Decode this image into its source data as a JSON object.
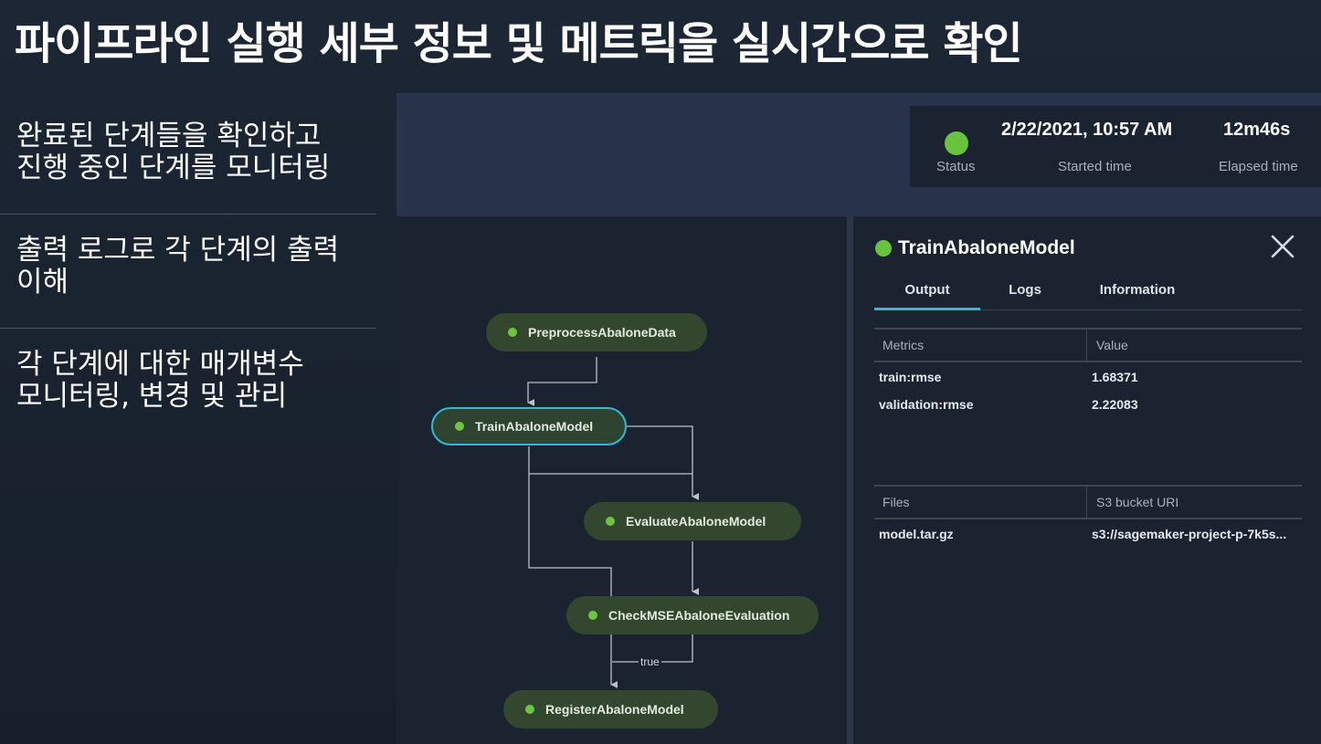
{
  "slide": {
    "title": "파이프라인 실행 세부 정보 및 메트릭을 실시간으로 확인",
    "bullets": [
      {
        "lines": [
          "완료된 단계들을 확인하고",
          "진행 중인 단계를 모니터링"
        ]
      },
      {
        "lines": [
          "출력 로그로 각 단계의 출력",
          "이해"
        ]
      },
      {
        "lines": [
          "각 단계에 대한 매개변수",
          "모니터링, 변경 및 관리"
        ]
      }
    ]
  },
  "header": {
    "status_label": "Status",
    "status_color": "#69c33f",
    "started_time": "2/22/2021, 10:57 AM",
    "started_label": "Started time",
    "elapsed_time": "12m46s",
    "elapsed_label": "Elapsed time"
  },
  "graph": {
    "nodes": [
      {
        "label": "PreprocessAbaloneData"
      },
      {
        "label": "TrainAbaloneModel"
      },
      {
        "label": "EvaluateAbaloneModel"
      },
      {
        "label": "CheckMSEAbaloneEvaluation"
      },
      {
        "label": "RegisterAbaloneModel"
      }
    ],
    "edge_label": "true",
    "selected_color": "#37b6d6",
    "success_color": "#6dc542"
  },
  "detail": {
    "title": "TrainAbaloneModel",
    "tabs": [
      "Output",
      "Logs",
      "Information"
    ],
    "active_tab": "Output",
    "metrics_header": [
      "Metrics",
      "Value"
    ],
    "metrics": [
      {
        "name": "train:rmse",
        "value": "1.68371"
      },
      {
        "name": "validation:rmse",
        "value": "2.22083"
      }
    ],
    "files_header": [
      "Files",
      "S3 bucket URI"
    ],
    "files": [
      {
        "name": "model.tar.gz",
        "uri": "s3://sagemaker-project-p-7k5s..."
      }
    ]
  }
}
